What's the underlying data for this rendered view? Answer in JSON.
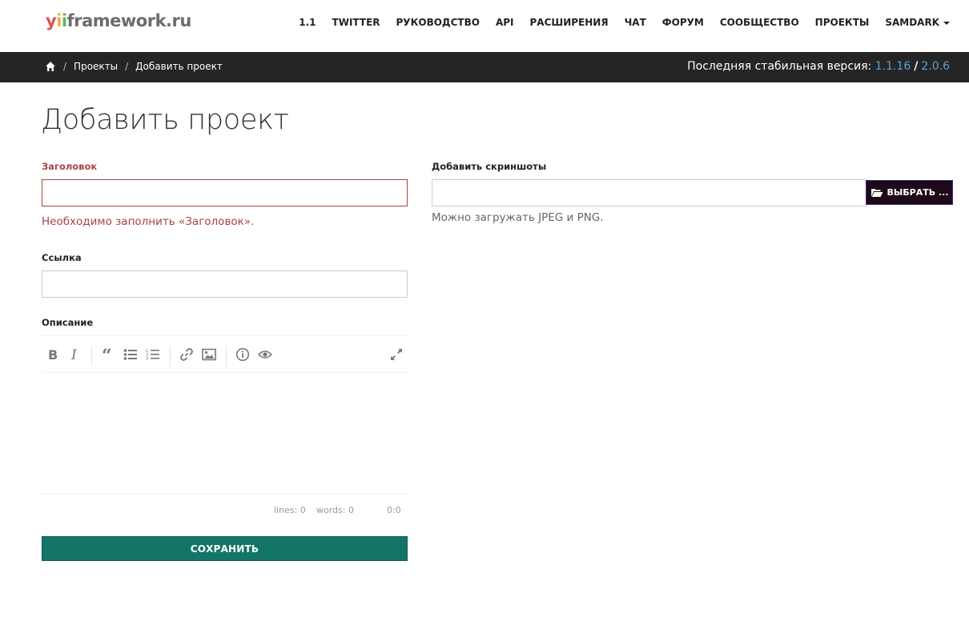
{
  "header": {
    "logo": {
      "yii_y": "y",
      "yii_i1": "i",
      "yii_i2": "i",
      "rest": "framework.ru"
    },
    "nav": [
      {
        "label": "1.1"
      },
      {
        "label": "TWITTER"
      },
      {
        "label": "РУКОВОДСТВО"
      },
      {
        "label": "API"
      },
      {
        "label": "РАСШИРЕНИЯ"
      },
      {
        "label": "ЧАТ"
      },
      {
        "label": "ФОРУМ"
      },
      {
        "label": "СООБЩЕСТВО"
      },
      {
        "label": "ПРОЕКТЫ"
      },
      {
        "label": "SAMDARK"
      }
    ]
  },
  "breadcrumb": {
    "home_icon": "home-icon",
    "items": [
      {
        "label": "Проекты"
      },
      {
        "label": "Добавить проект"
      }
    ],
    "separator": "/"
  },
  "version": {
    "label": "Последняя стабильная версия:",
    "v1": "1.1.16",
    "separator": "/",
    "v2": "2.0.6",
    "link_color": "#5aa3d6"
  },
  "page": {
    "title": "Добавить проект"
  },
  "form": {
    "title_label": "Заголовок",
    "title_value": "",
    "title_error": "Необходимо заполнить «Заголовок».",
    "link_label": "Ссылка",
    "link_value": "",
    "description_label": "Описание",
    "editor_toolbar": [
      "bold-icon",
      "italic-icon",
      "quote-icon",
      "unordered-list-icon",
      "ordered-list-icon",
      "link-icon",
      "image-icon",
      "info-icon",
      "preview-icon",
      "fullscreen-icon"
    ],
    "status": {
      "lines": "lines: 0",
      "words": "words: 0",
      "cursor": "0:0"
    },
    "save_label": "СОХРАНИТЬ",
    "screenshots_label": "Добавить скриншоты",
    "file_value": "",
    "file_button_label": "ВЫБРАТЬ ...",
    "file_help": "Можно загружать JPEG и PNG."
  },
  "colors": {
    "darkbar": "#252525",
    "error": "#a94442",
    "save_button": "#127567",
    "file_button": "#1d0a16"
  }
}
